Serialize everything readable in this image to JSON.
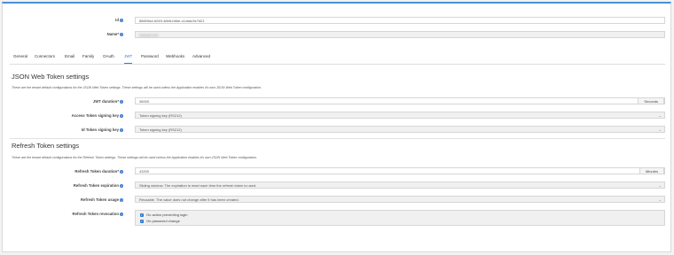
{
  "id_field": {
    "label": "Id",
    "value": "88609a4-b049-48e8-b6be-c1cbac3e7d21"
  },
  "name_field": {
    "label": "Name",
    "required_mark": "*",
    "value": "xxxxxxx-xxx"
  },
  "tabs": [
    "General",
    "Connectors",
    "Email",
    "Family",
    "OAuth",
    "JWT",
    "Password",
    "Webhooks",
    "Advanced"
  ],
  "active_tab": "JWT",
  "jwt_section": {
    "title": "JSON Web Token settings",
    "description": "These are the tenant default configurations for the JSON Web Token settings. These settings will be used unless the Application enables it's own JSON Web Token configuration.",
    "duration": {
      "label": "JWT duration",
      "required_mark": "*",
      "value": "36000",
      "unit": "Seconds"
    },
    "access_key": {
      "label": "Access Token signing key",
      "value": "Token signing key (RS212)"
    },
    "id_key": {
      "label": "Id Token signing key",
      "value": "Token signing key (RS212)"
    }
  },
  "refresh_section": {
    "title": "Refresh Token settings",
    "description": "These are the tenant default configurations for the Refresh Token settings. These settings will be used unless the Application enables it's own JSON Web Token configuration.",
    "duration": {
      "label": "Refresh Token duration",
      "required_mark": "*",
      "value": "43200",
      "unit": "Minutes"
    },
    "expiration": {
      "label": "Refresh Token expiration",
      "value": "Sliding window. The expiration is reset each time the refresh token is used."
    },
    "usage": {
      "label": "Refresh Token usage",
      "value": "Reusable. The value does not change after it has been created."
    },
    "revocation": {
      "label": "Refresh Token revocation",
      "options": [
        {
          "label": "On action preventing login",
          "checked": true
        },
        {
          "label": "On password change",
          "checked": true
        }
      ]
    }
  },
  "colors": {
    "accent": "#3a7bd5",
    "top_border": "#4a90d9"
  },
  "icons": {
    "info": "info-icon",
    "chevron": "chevron-down-icon",
    "check": "checkbox-checked-icon"
  }
}
